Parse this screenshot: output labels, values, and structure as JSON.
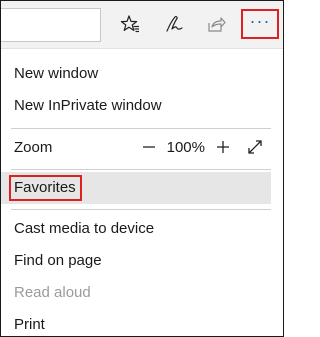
{
  "toolbar": {
    "address_value": "",
    "icons": [
      "favorites-star-icon",
      "pen-icon",
      "share-icon",
      "more-icon"
    ],
    "more_glyph": "···"
  },
  "menu": {
    "new_window": "New window",
    "new_inprivate": "New InPrivate window",
    "zoom_label": "Zoom",
    "zoom_minus": "—",
    "zoom_value": "100%",
    "zoom_plus": "+",
    "favorites": "Favorites",
    "cast_media": "Cast media to device",
    "find_on_page": "Find on page",
    "read_aloud": "Read aloud",
    "print": "Print"
  },
  "colors": {
    "highlight_border": "#e02020",
    "hover_background": "#e6e6e6",
    "disabled_text": "#9b9b9b"
  }
}
